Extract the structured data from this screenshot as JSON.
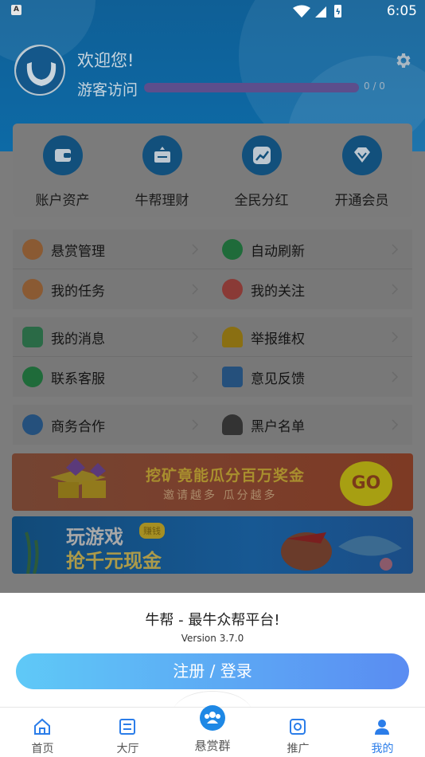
{
  "status_bar": {
    "notification_icon": "A",
    "time": "6:05"
  },
  "profile": {
    "welcome": "欢迎您!",
    "guest_label": "游客访问",
    "progress_value": 0,
    "progress_text": "0 / 0",
    "settings_icon": "gear-icon"
  },
  "quick_actions": [
    {
      "label": "账户资产",
      "icon": "wallet-icon"
    },
    {
      "label": "牛帮理财",
      "icon": "finance-icon"
    },
    {
      "label": "全民分红",
      "icon": "trend-up-icon"
    },
    {
      "label": "开通会员",
      "icon": "diamond-icon"
    }
  ],
  "menu_groups": [
    [
      {
        "label": "悬赏管理",
        "icon": "money-bag-icon",
        "color": "#8a5a33"
      },
      {
        "label": "自动刷新",
        "icon": "refresh-icon",
        "color": "#1f6b3a"
      },
      {
        "label": "我的任务",
        "icon": "task-icon",
        "color": "#8a5a33"
      },
      {
        "label": "我的关注",
        "icon": "heart-icon",
        "color": "#8a3a36"
      }
    ],
    [
      {
        "label": "我的消息",
        "icon": "message-icon",
        "color": "#2a6a46"
      },
      {
        "label": "举报维权",
        "icon": "alarm-icon",
        "color": "#8a6f12"
      },
      {
        "label": "联系客服",
        "icon": "headset-icon",
        "color": "#1f6b3a"
      },
      {
        "label": "意见反馈",
        "icon": "feedback-icon",
        "color": "#25507c"
      }
    ],
    [
      {
        "label": "商务合作",
        "icon": "cooperation-icon",
        "color": "#25507c"
      },
      {
        "label": "黑户名单",
        "icon": "blacklist-icon",
        "color": "#333333"
      }
    ]
  ],
  "banners": {
    "mining": {
      "title": "挖矿竟能瓜分百万奖金",
      "subtitle": "邀请越多 瓜分越多",
      "button": "GO"
    },
    "game": {
      "line1": "玩游戏",
      "tag": "赚钱",
      "line2": "抢千元现金"
    }
  },
  "login_sheet": {
    "title": "牛帮 - 最牛众帮平台!",
    "version": "Version 3.7.0",
    "button": "注册 / 登录"
  },
  "tabbar": {
    "items": [
      {
        "label": "首页",
        "icon": "home-icon"
      },
      {
        "label": "大厅",
        "icon": "hall-icon"
      },
      {
        "label": "悬赏群",
        "icon": "group-icon"
      },
      {
        "label": "推广",
        "icon": "promote-icon"
      },
      {
        "label": "我的",
        "icon": "user-icon"
      }
    ],
    "active_index": 4
  },
  "colors": {
    "accent": "#2b7de9",
    "header": "#0f5f96",
    "button_start": "#5fc9f7",
    "button_end": "#5a8cf2"
  }
}
